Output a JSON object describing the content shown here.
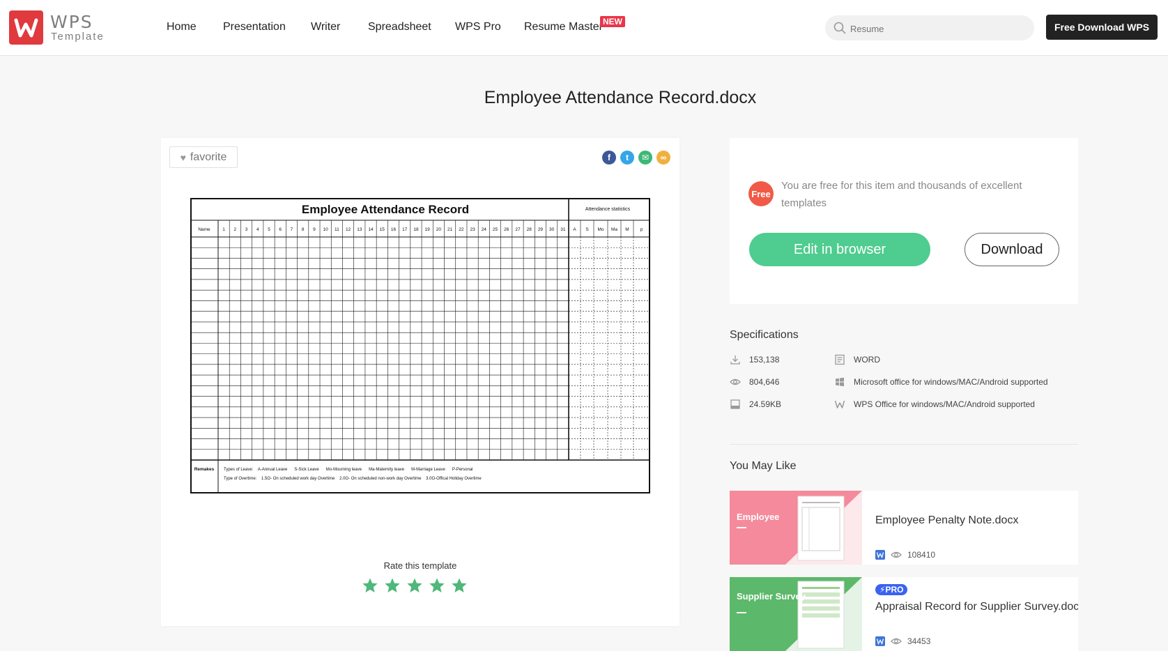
{
  "header": {
    "logo_main": "WPS",
    "logo_sub": "Template",
    "nav": [
      {
        "label": "Home"
      },
      {
        "label": "Presentation"
      },
      {
        "label": "Writer"
      },
      {
        "label": "Spreadsheet"
      },
      {
        "label": "WPS Pro"
      },
      {
        "label": "Resume Master"
      }
    ],
    "new_badge": "NEW",
    "search_placeholder": "Resume",
    "download_button": "Free Download WPS"
  },
  "page_title": "Employee Attendance Record.docx",
  "preview": {
    "favorite_label": "favorite",
    "share_icons": [
      "facebook-icon",
      "twitter-icon",
      "email-icon",
      "link-icon"
    ],
    "document": {
      "title": "Employee Attendance Record",
      "stats_header": "Attendance statistics",
      "name_col": "Name",
      "days": [
        "1",
        "2",
        "3",
        "4",
        "5",
        "6",
        "7",
        "8",
        "9",
        "10",
        "11",
        "12",
        "13",
        "14",
        "15",
        "16",
        "17",
        "18",
        "19",
        "20",
        "21",
        "22",
        "23",
        "24",
        "25",
        "26",
        "27",
        "28",
        "29",
        "30",
        "31"
      ],
      "stat_cols": [
        "A",
        "S",
        "Mo",
        "Ma",
        "M",
        "p"
      ],
      "remarks_label": "Remakes",
      "leave_line": "Types of Leave:    A-Annual Leave      S-Sick Leave      Mo-Mourning leave      Ma-Maternity leave      M-Marriage Leave      P-Personal",
      "overtime_line": "Type of Overtime:    1.5O- On scheduled work day Overtime    2.0O- On scheduled non-work day Overtime    3.0O-Offical Holiday Overtime"
    },
    "rate_label": "Rate this template",
    "rating": 5
  },
  "action": {
    "free_badge": "Free",
    "free_text": "You are free for this item and thousands of excellent templates",
    "edit_button": "Edit in browser",
    "download_button": "Download"
  },
  "specifications": {
    "title": "Specifications",
    "downloads": "153,138",
    "views": "804,646",
    "size": "24.59KB",
    "format": "WORD",
    "compat_ms": "Microsoft office for windows/MAC/Android supported",
    "compat_wps": "WPS Office for windows/MAC/Android supported"
  },
  "you_may_like": {
    "title": "You May Like",
    "items": [
      {
        "name": "Employee Penalty Note.docx",
        "views": "108410",
        "thumb_title": "Employee",
        "thumb_color": "#f48a9b"
      },
      {
        "name": "Appraisal Record for Supplier Survey.docx",
        "views": "34453",
        "thumb_title": "Supplier Survey",
        "thumb_color": "#5cb86a",
        "pro": "PRO"
      }
    ]
  },
  "colors": {
    "brand_red": "#e0393e",
    "edit_green": "#4fcc8f",
    "free_orange": "#f05a47",
    "star_green": "#4fb87a"
  }
}
